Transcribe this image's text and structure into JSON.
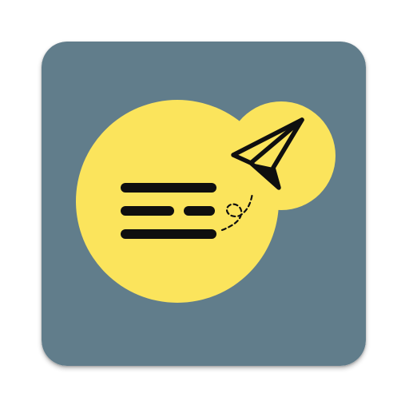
{
  "app_icon": {
    "name": "notes-send-app-icon",
    "colors": {
      "background": "#617d8b",
      "bubble": "#fbe45c",
      "stroke": "#0f0f0f"
    },
    "icons": [
      "text-lines-icon",
      "dotted-trail-icon",
      "paper-plane-icon"
    ]
  }
}
